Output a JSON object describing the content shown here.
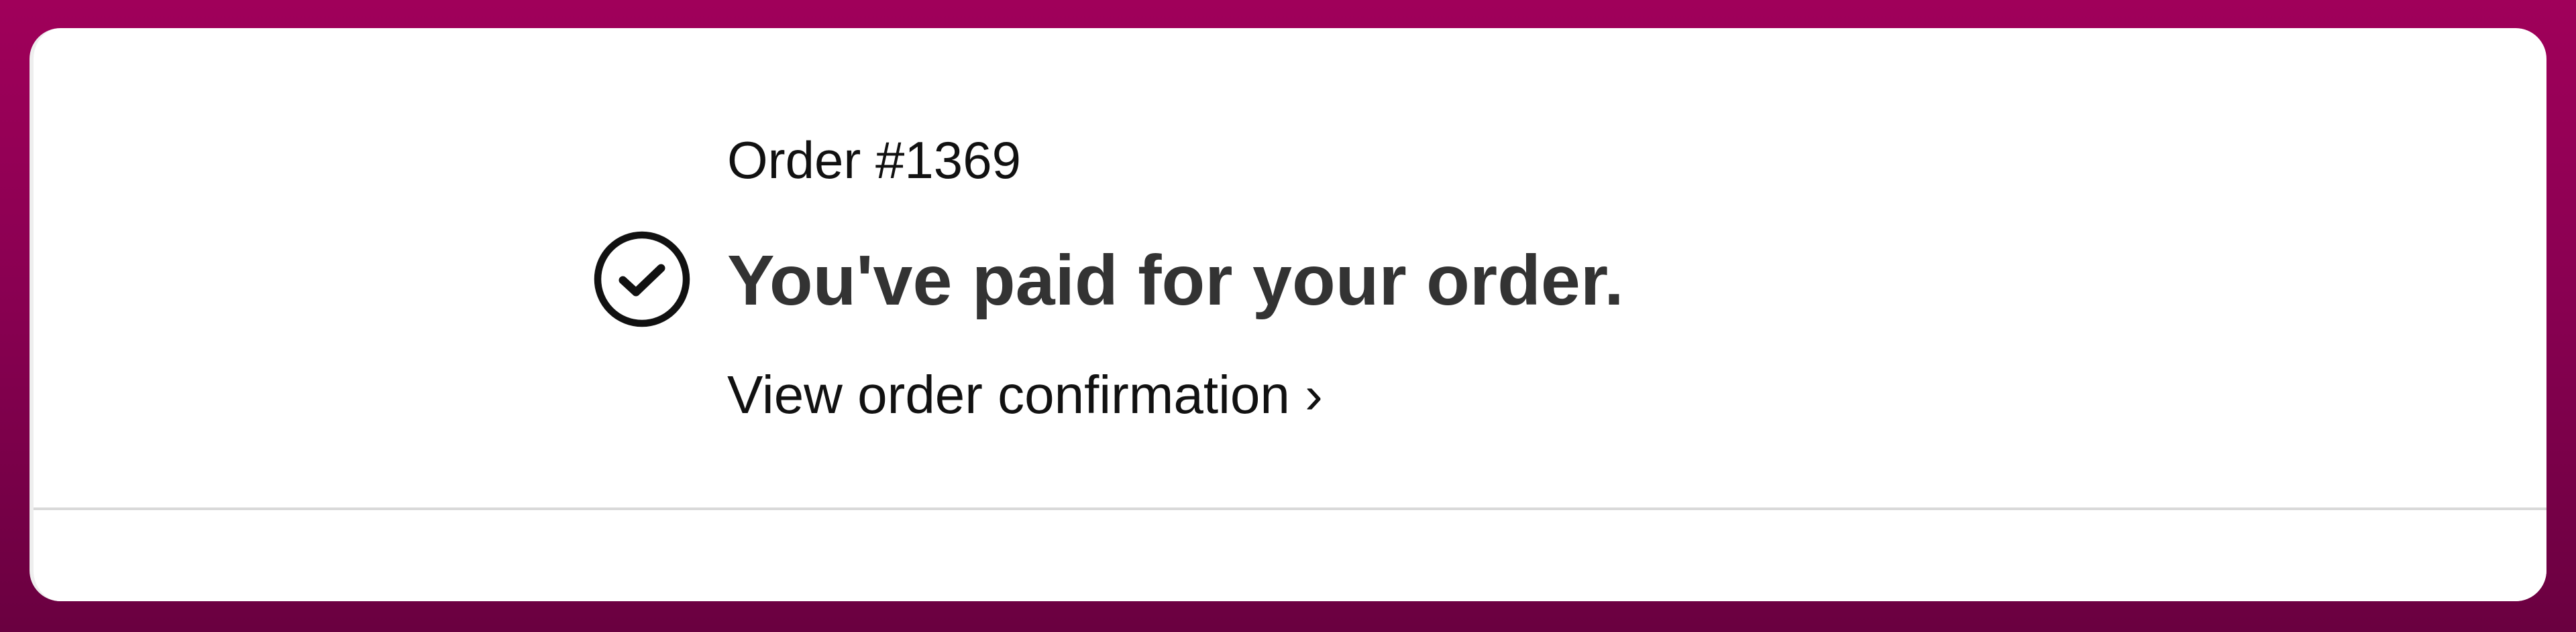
{
  "order": {
    "number_label": "Order #1369",
    "status_message": "You've paid for your order.",
    "confirmation_link": "View order confirmation ›"
  },
  "icons": {
    "status": "check-circle-icon"
  },
  "colors": {
    "background": "#a0005a",
    "card": "#ffffff",
    "headline": "#333333",
    "text": "#111111"
  }
}
